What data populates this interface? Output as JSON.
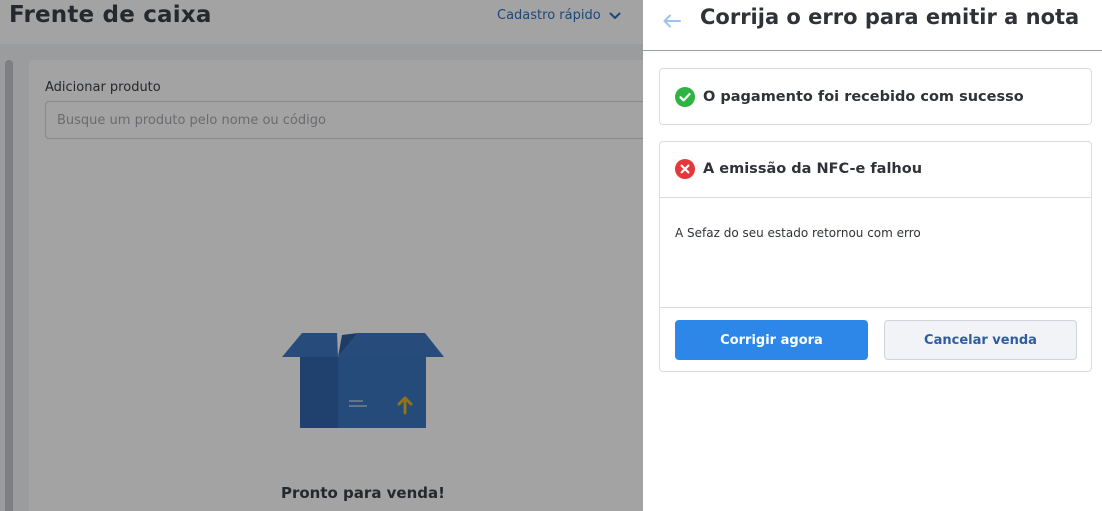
{
  "page": {
    "title": "Frente de caixa",
    "quick_register_label": "Cadastro rápido",
    "add_product_label": "Adicionar produto",
    "search_placeholder": "Busque um produto pelo nome ou código",
    "empty_state_text": "Pronto para venda!"
  },
  "drawer": {
    "title": "Corrija o erro para emitir a nota",
    "success": {
      "icon": "check-circle-icon",
      "text": "O pagamento foi recebido com sucesso",
      "color": "#2fb344"
    },
    "error": {
      "icon": "error-x-circle-icon",
      "text": "A emissão da NFC-e falhou",
      "message": "A Sefaz do seu estado retornou com erro",
      "color": "#e5383b"
    },
    "actions": {
      "primary_label": "Corrigir agora",
      "secondary_label": "Cancelar venda"
    }
  },
  "colors": {
    "primary": "#2c87e8",
    "link": "#2f6fbf",
    "overlay": "rgba(0,0,0,0.36)"
  }
}
